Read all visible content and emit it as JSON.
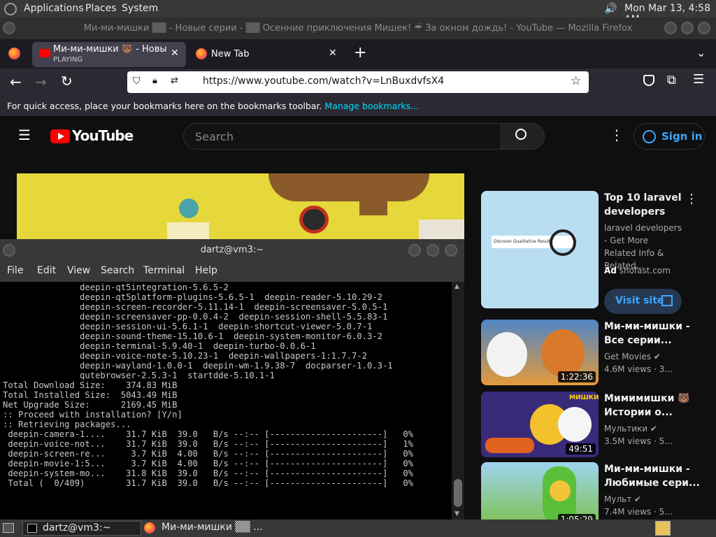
{
  "topbar": {
    "applications": "Applications",
    "places": "Places",
    "system": "System",
    "clock": "Mon Mar 13,  4:58 AM"
  },
  "firefox": {
    "window_title": "Ми-ми-мишки ▒▒ - Новые серии - ▒▒ Осенние приключения Мишек! ☔ За окном дождь! - YouTube — Mozilla Firefox",
    "tabs": [
      {
        "title": "Ми-ми-мишки 🐻 - Новые с",
        "sub": "PLAYING"
      },
      {
        "title": "New Tab"
      }
    ],
    "url": "https://www.youtube.com/watch?v=LnBuxdvfsX4",
    "bookmarks_msg": "For quick access, place your bookmarks here on the bookmarks toolbar.",
    "manage_bookmarks": "Manage bookmarks..."
  },
  "youtube": {
    "logo": "YouTube",
    "search_placeholder": "Search",
    "sign_in": "Sign in",
    "ad": {
      "title": "Top 10 laravel developers",
      "desc": "laravel developers - Get More Related Info & Related...",
      "ad_label": "Ad",
      "domain": "shofast.com",
      "cta": "Visit site",
      "thumb_text": "Discover Qualitative Results"
    },
    "recs": [
      {
        "title": "Ми-ми-мишки - Все серии...",
        "channel": "Get Movies",
        "meta": "4.6M views · 3...",
        "duration": "1:22:36"
      },
      {
        "title": "Мимимишки 🐻 Истории о...",
        "channel": "Мультики",
        "meta": "3.5M views · 5...",
        "duration": "49:51",
        "thumb_text": "МИШКИ"
      },
      {
        "title": "Ми-ми-мишки - Любимые сери...",
        "channel": "Мульт",
        "meta": "7.4M views · 5...",
        "duration": "1:05:29"
      }
    ]
  },
  "terminal": {
    "title": "dartz@vm3:~",
    "menu": [
      "File",
      "Edit",
      "View",
      "Search",
      "Terminal",
      "Help"
    ],
    "lines": [
      "               deepin-qt5integration-5.6.5-2",
      "               deepin-qt5platform-plugins-5.6.5-1  deepin-reader-5.10.29-2",
      "               deepin-screen-recorder-5.11.14-1  deepin-screensaver-5.0.5-1",
      "               deepin-screensaver-pp-0.0.4-2  deepin-session-shell-5.5.83-1",
      "               deepin-session-ui-5.6.1-1  deepin-shortcut-viewer-5.0.7-1",
      "               deepin-sound-theme-15.10.6-1  deepin-system-monitor-6.0.3-2",
      "               deepin-terminal-5.9.40-1  deepin-turbo-0.0.6-1",
      "               deepin-voice-note-5.10.23-1  deepin-wallpapers-1:1.7.7-2",
      "               deepin-wayland-1.0.0-1  deepin-wm-1.9.38-7  docparser-1.0.3-1",
      "               qutebrowser-2.5.3-1  startdde-5.10.1-1",
      "",
      "Total Download Size:    374.83 MiB",
      "Total Installed Size:  5043.49 MiB",
      "Net Upgrade Size:      2169.45 MiB",
      "",
      ":: Proceed with installation? [Y/n]",
      ":: Retrieving packages...",
      " deepin-camera-1....    31.7 KiB  39.0   B/s --:-- [----------------------]   0%",
      " deepin-voice-not...    31.7 KiB  39.0   B/s --:-- [----------------------]   1%",
      " deepin-screen-re...     3.7 KiB  4.00   B/s --:-- [----------------------]   0%",
      " deepin-movie-1:5...     3.7 KiB  4.00   B/s --:-- [----------------------]   0%",
      " deepin-system-mo...    31.8 KiB  39.0   B/s --:-- [----------------------]   0%",
      " Total (  0/409)        31.7 KiB  39.0   B/s --:-- [----------------------]   0%"
    ]
  },
  "taskbar": {
    "items": [
      "dartz@vm3:~",
      "Ми-ми-мишки ▒▒ ..."
    ]
  }
}
